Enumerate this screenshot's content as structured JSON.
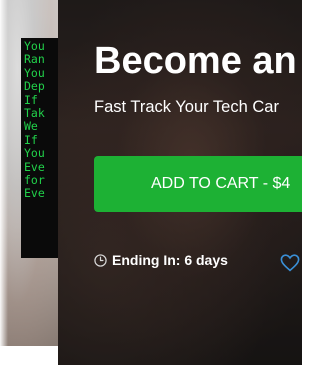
{
  "thumbnail": {
    "terminal_lines": [
      "You",
      "Ran",
      "You",
      "Dep",
      "If",
      "Tak",
      "We",
      "If",
      "You",
      "Eve",
      "for",
      "Eve"
    ]
  },
  "hero": {
    "title": "Become an",
    "subtitle": "Fast Track Your Tech Car",
    "cart_button_label": "ADD TO CART - $4",
    "ending_label": "Ending In: 6 days",
    "clock_icon": "clock-icon",
    "heart_icon": "heart-icon"
  },
  "colors": {
    "cart_button": "#1db134",
    "terminal_text": "#21d14a",
    "heart": "#3a8fd6"
  }
}
